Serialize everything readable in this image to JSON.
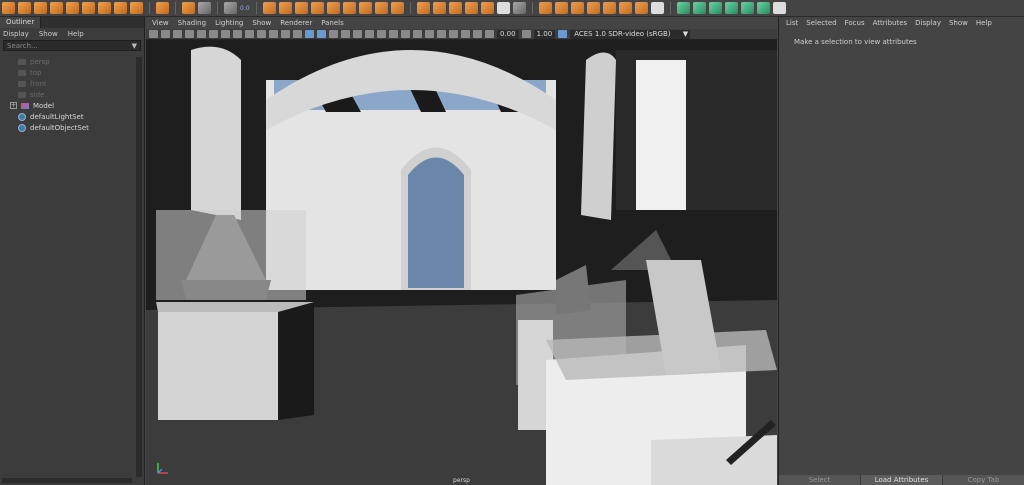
{
  "shelf": {
    "icons": [
      "poly-sphere-icon",
      "poly-cube-icon",
      "poly-cylinder-icon",
      "poly-cone-icon",
      "poly-torus-icon",
      "poly-plane-icon",
      "poly-disc-icon",
      "poly-platonic-icon",
      "poly-pyramid-icon",
      "poly-prism-icon",
      "sweep-mesh-icon",
      "combine-icon",
      "separate-icon",
      "smooth-icon",
      "bridge-icon",
      "bevel-icon",
      "extrude-icon",
      "multi-cut-icon",
      "target-weld-icon",
      "boolean-icon",
      "mirror-icon",
      "uv-editor-icon",
      "planar-map-icon",
      "auto-map-icon",
      "camera-map-icon"
    ],
    "value_label": "0.0"
  },
  "outliner": {
    "tab_label": "Outliner",
    "menu": [
      "Display",
      "Show",
      "Help"
    ],
    "search_placeholder": "Search...",
    "items": [
      {
        "label": "persp",
        "kind": "camera"
      },
      {
        "label": "top",
        "kind": "camera"
      },
      {
        "label": "front",
        "kind": "camera"
      },
      {
        "label": "side",
        "kind": "camera"
      },
      {
        "label": "Model",
        "kind": "group"
      },
      {
        "label": "defaultLightSet",
        "kind": "set"
      },
      {
        "label": "defaultObjectSet",
        "kind": "set"
      }
    ]
  },
  "viewport": {
    "menu": [
      "View",
      "Shading",
      "Lighting",
      "Show",
      "Renderer",
      "Panels"
    ],
    "exposure": "0.00",
    "gamma": "1.00",
    "color_space": "ACES 1.0 SDR-video (sRGB)",
    "camera_label": "persp"
  },
  "attribute_editor": {
    "menu": [
      "List",
      "Selected",
      "Focus",
      "Attributes",
      "Display",
      "Show",
      "Help"
    ],
    "message": "Make a selection to view attributes",
    "buttons": [
      "Select",
      "Load Attributes",
      "Copy Tab"
    ]
  },
  "colors": {
    "shelf_orange": "#e08a3a",
    "viewport_bg": "#3a3a3a",
    "door_blue": "#6a86a8"
  }
}
